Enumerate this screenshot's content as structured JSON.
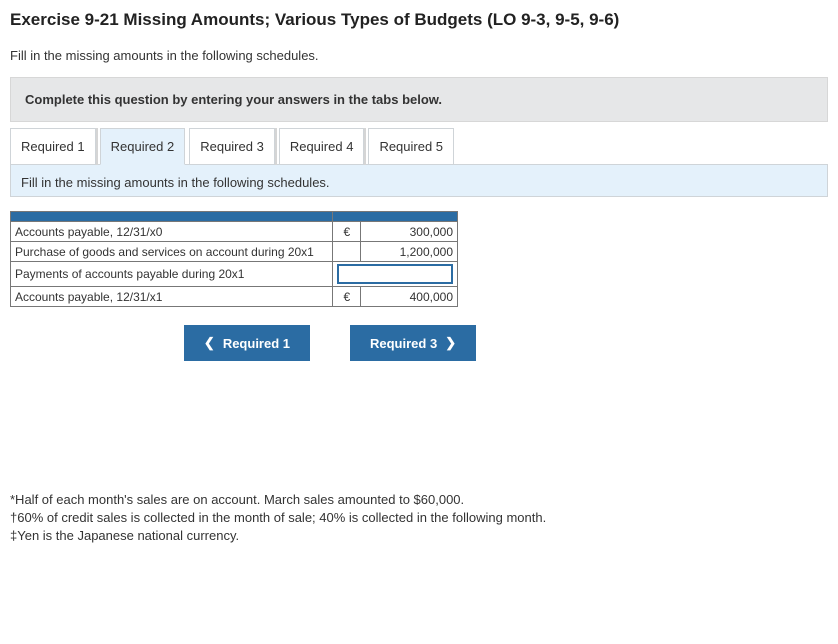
{
  "title": "Exercise 9-21 Missing Amounts; Various Types of Budgets (LO 9-3, 9-5, 9-6)",
  "instruction": "Fill in the missing amounts in the following schedules.",
  "greybox": "Complete this question by entering your answers in the tabs below.",
  "tabs": {
    "t1": "Required 1",
    "t2": "Required 2",
    "t3": "Required 3",
    "t4": "Required 4",
    "t5": "Required 5"
  },
  "panel_instruction": "Fill in the missing amounts in the following schedules.",
  "schedule": {
    "rows": [
      {
        "desc": "Accounts payable, 12/31/x0",
        "cur": "€",
        "val": "300,000"
      },
      {
        "desc": "Purchase of goods and services on account during 20x1",
        "cur": "",
        "val": "1,200,000"
      },
      {
        "desc": "Payments of accounts payable during 20x1",
        "cur": "",
        "val": "",
        "input": true
      },
      {
        "desc": "Accounts payable, 12/31/x1",
        "cur": "€",
        "val": "400,000"
      }
    ]
  },
  "nav": {
    "prev": "Required 1",
    "next": "Required 3"
  },
  "footnotes": {
    "f1": "*Half of each month's sales are on account. March sales amounted to $60,000.",
    "f2": "†60% of credit sales is collected in the month of sale; 40% is collected in the following month.",
    "f3": "‡Yen is the Japanese national currency."
  }
}
